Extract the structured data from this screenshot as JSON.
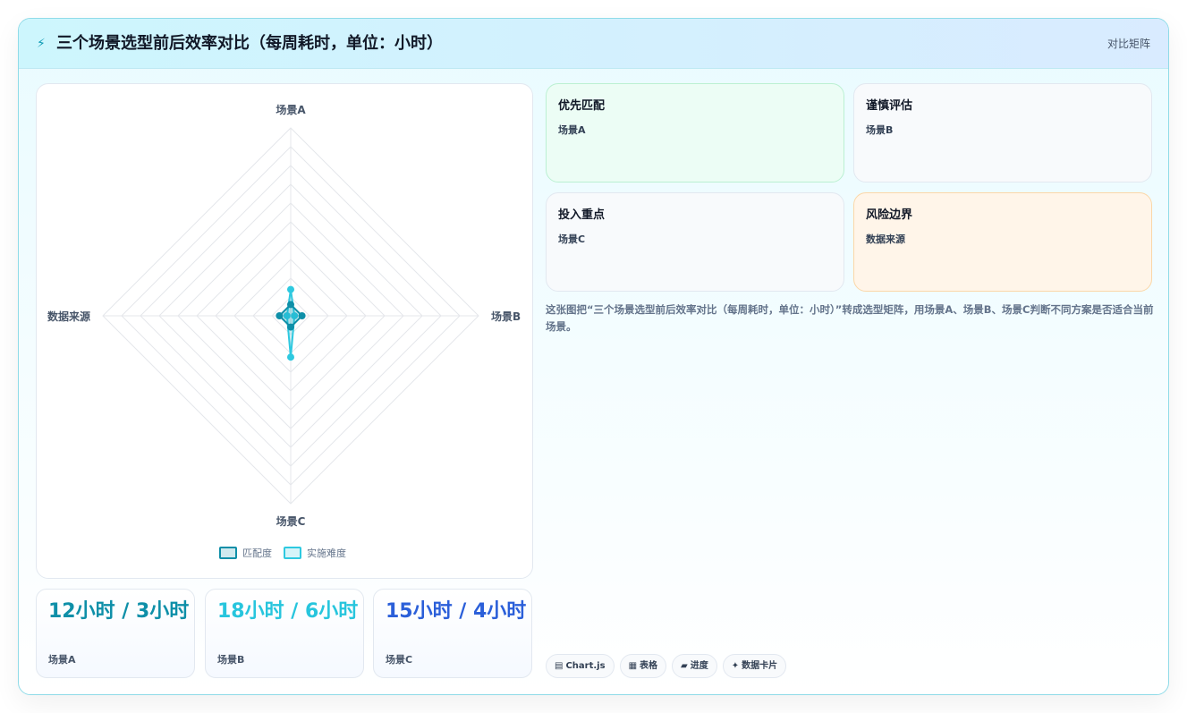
{
  "header": {
    "icon": "lightning-icon",
    "title": "三个场景选型前后效率对比（每周耗时，单位：小时）",
    "tag": "对比矩阵"
  },
  "chart_data": {
    "type": "radar",
    "axes": [
      "场景A",
      "场景B",
      "场景C",
      "数据来源"
    ],
    "range": [
      0,
      100
    ],
    "series": [
      {
        "name": "匹配度",
        "values": [
          6,
          6,
          6,
          6
        ],
        "color": "#0e8fa8"
      },
      {
        "name": "实施难度",
        "values": [
          14,
          2,
          22,
          2
        ],
        "color": "#2ec9e0"
      }
    ]
  },
  "kpis": [
    {
      "value": "12小时 / 3小时",
      "label": "场景A",
      "color": "#0e8fa8"
    },
    {
      "value": "18小时 / 6小时",
      "label": "场景B",
      "color": "#27c5dd"
    },
    {
      "value": "15小时 / 4小时",
      "label": "场景C",
      "color": "#2b5fd9"
    }
  ],
  "tiles": [
    {
      "title": "优先匹配",
      "sub": "场景A"
    },
    {
      "title": "谨慎评估",
      "sub": "场景B"
    },
    {
      "title": "投入重点",
      "sub": "场景C"
    },
    {
      "title": "风险边界",
      "sub": "数据来源"
    }
  ],
  "description": "这张图把“三个场景选型前后效率对比（每周耗时，单位：小时）”转成选型矩阵，用场景A、场景B、场景C判断不同方案是否适合当前场景。",
  "chips": [
    {
      "icon": "chart-icon",
      "label": "Chart.js"
    },
    {
      "icon": "table-icon",
      "label": "表格"
    },
    {
      "icon": "progress-icon",
      "label": "进度"
    },
    {
      "icon": "sparkle-icon",
      "label": "数据卡片"
    }
  ]
}
